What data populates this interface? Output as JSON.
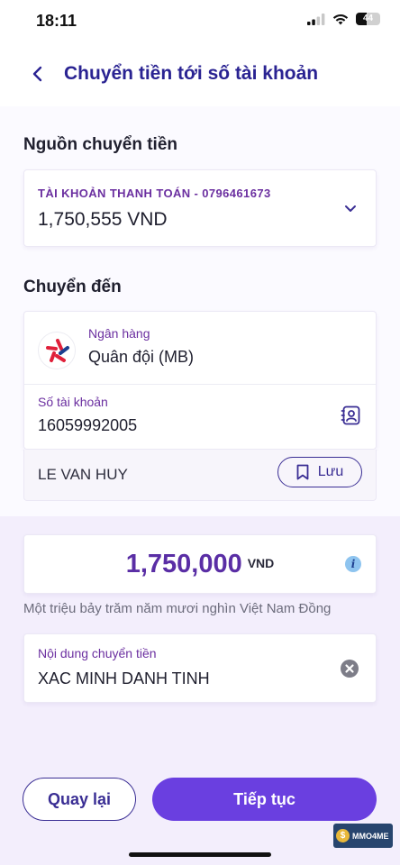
{
  "status_bar": {
    "time": "18:11",
    "battery": "44"
  },
  "header": {
    "title": "Chuyển tiền tới số tài khoản"
  },
  "source": {
    "section_title": "Nguồn chuyển tiền",
    "account_label": "TÀI KHOẢN THANH TOÁN - 0796461673",
    "balance": "1,750,555 VND"
  },
  "destination": {
    "section_title": "Chuyển đến",
    "bank_label": "Ngân hàng",
    "bank_value": "Quân đội (MB)",
    "account_label": "Số tài khoản",
    "account_value": "16059992005",
    "holder_name": "LE VAN HUY",
    "save_label": "Lưu"
  },
  "amount": {
    "value": "1,750,000",
    "unit": "VND",
    "in_words": "Một triệu bảy trăm năm mươi nghìn Việt Nam Đồng"
  },
  "memo": {
    "label": "Nội dung chuyển tiền",
    "value": "XAC MINH DANH TINH"
  },
  "actions": {
    "back_label": "Quay lại",
    "next_label": "Tiếp tục"
  },
  "watermark": {
    "text": "MMO4ME"
  },
  "colors": {
    "primary": "#6a3fe0",
    "title": "#2a2392",
    "label": "#6b2fa0",
    "background_tint": "#f3eefc"
  }
}
